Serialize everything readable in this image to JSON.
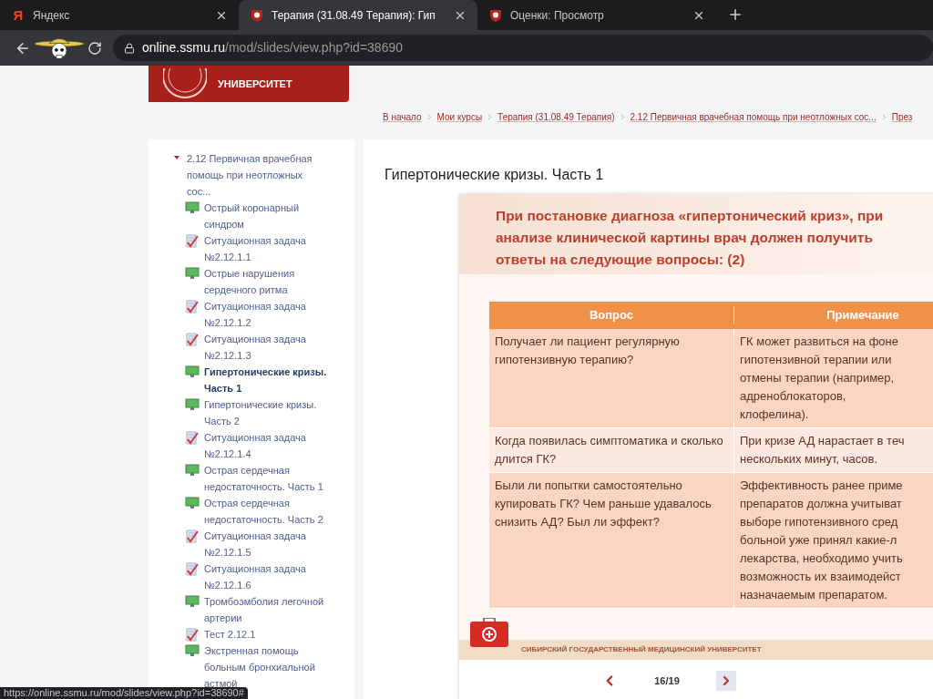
{
  "browser": {
    "tabs": [
      {
        "title": "Яндекс",
        "favicon": {
          "kind": "letter",
          "text": "Я"
        },
        "selected": false
      },
      {
        "title": "Терапия (31.08.49 Терапия): Гип",
        "favicon": {
          "kind": "shield"
        },
        "selected": true
      },
      {
        "title": "Оценки: Просмотр",
        "favicon": {
          "kind": "shield"
        },
        "selected": false
      }
    ],
    "address": {
      "host": "online.ssmu.ru",
      "path": "/mod/slides/view.php?id=38690"
    },
    "status_url": "https://online.ssmu.ru/mod/slides/view.php?id=38690#"
  },
  "logo": {
    "text": "УНИВЕРСИТЕТ"
  },
  "breadcrumbs": [
    "В начало",
    "Мои курсы",
    "Терапия (31.08.49 Терапия)",
    "2.12 Первичная врачебная помощь при неотложных сос...",
    "През"
  ],
  "sidebar": {
    "items": [
      {
        "label": "2.12 Первичная врачебная помощь при неотложных сос...",
        "expanded": true,
        "children": [
          {
            "label": "Острый коронарный синдром",
            "kind": "slides",
            "selected": false
          },
          {
            "label": "Ситуационная задача №2.12.1.1",
            "kind": "task",
            "selected": false
          },
          {
            "label": "Острые нарушения сердечного ритма",
            "kind": "slides",
            "selected": false
          },
          {
            "label": "Ситуационная задача №2.12.1.2",
            "kind": "task",
            "selected": false
          },
          {
            "label": "Ситуационная задача №2.12.1.3",
            "kind": "task",
            "selected": false
          },
          {
            "label": "Гипертонические кризы. Часть 1",
            "kind": "slides",
            "selected": true
          },
          {
            "label": "Гипертонические кризы. Часть 2",
            "kind": "slides",
            "selected": false
          },
          {
            "label": "Ситуационная задача №2.12.1.4",
            "kind": "task",
            "selected": false
          },
          {
            "label": "Острая сердечная недостаточность. Часть 1",
            "kind": "slides",
            "selected": false
          },
          {
            "label": "Острая сердечная недостаточность. Часть 2",
            "kind": "slides",
            "selected": false
          },
          {
            "label": "Ситуационная задача №2.12.1.5",
            "kind": "task",
            "selected": false
          },
          {
            "label": "Ситуационная задача №2.12.1.6",
            "kind": "task",
            "selected": false
          },
          {
            "label": "Тромбоэмболия легочной артерии",
            "kind": "slides",
            "selected": false
          },
          {
            "label": "Тест 2.12.1",
            "kind": "task",
            "selected": false
          },
          {
            "label": "Экстренная помощь больным бронхиальной астмой",
            "kind": "slides",
            "selected": false
          }
        ]
      }
    ]
  },
  "main": {
    "title": "Гипертонические кризы. Часть 1",
    "slide": {
      "heading": "При постановке диагноза «гипертонический криз», при анализе клинической картины врач должен получить ответы на следующие вопросы: (2)",
      "table": {
        "columns": [
          "Вопрос",
          "Примечание"
        ],
        "rows": [
          {
            "cells": [
              "Получает ли пациент регулярную гипотензивную терапию?",
              [
                "ГК может развиться на фоне",
                "гипотензивной терапии или",
                "отмены терапии (например,",
                "адреноблокаторов,",
                "клофелина)."
              ]
            ]
          },
          {
            "cells": [
              "Когда появилась симптоматика и сколько длится ГК?",
              [
                "При кризе АД нарастает в теч",
                "нескольких минут, часов."
              ]
            ]
          },
          {
            "cells": [
              "Были ли попытки самостоятельно купировать ГК? Чем раньше удавалось снизить АД? Был ли эффект?",
              [
                "Эффективность ранее приме",
                "препаратов должна учитыват",
                "выборе гипотензивного сред",
                "больной уже принял какие-л",
                "лекарства, необходимо учить",
                "возможность их взаимодейст",
                "назначаемым препаратом."
              ]
            ]
          }
        ]
      },
      "footer": "СИБИРСКИЙ ГОСУДАРСТВЕННЫЙ МЕДИЦИНСКИЙ УНИВЕРСИТЕТ"
    },
    "pager": "16/19"
  }
}
